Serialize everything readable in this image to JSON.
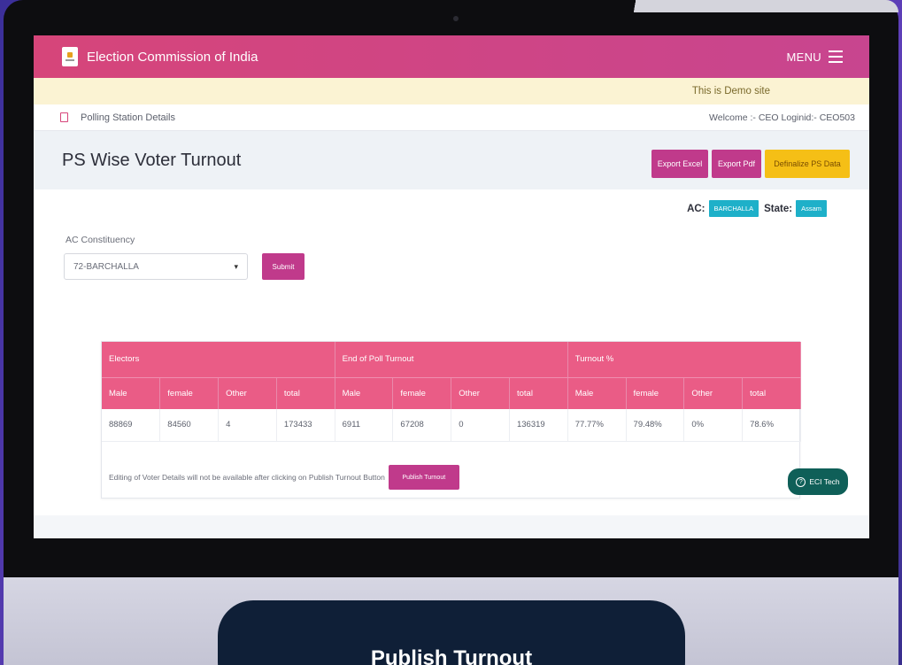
{
  "header": {
    "brand": "Election Commission of India",
    "menu_label": "MENU"
  },
  "demo_notice": "This is Demo site",
  "breadcrumb": {
    "label": "Polling Station Details",
    "welcome": "Welcome :- CEO Loginid:- CEO503"
  },
  "page": {
    "title": "PS Wise Voter Turnout",
    "export_excel": "Export Excel",
    "export_pdf": "Export Pdf",
    "definalize": "Definalize PS Data"
  },
  "context": {
    "ac_label": "AC:",
    "ac_value": "BARCHALLA",
    "state_label": "State:",
    "state_value": "Assam"
  },
  "form": {
    "label": "AC Constituency",
    "selected": "72-BARCHALLA",
    "submit": "Submit"
  },
  "table": {
    "groups": [
      "Electors",
      "End of Poll Turnout",
      "Turnout %"
    ],
    "columns": [
      "Male",
      "female",
      "Other",
      "total",
      "Male",
      "female",
      "Other",
      "total",
      "Male",
      "female",
      "Other",
      "total"
    ],
    "row": [
      "88869",
      "84560",
      "4",
      "173433",
      "6911",
      "67208",
      "0",
      "136319",
      "77.77%",
      "79.48%",
      "0%",
      "78.6%"
    ]
  },
  "note": {
    "text": "Editing of Voter Details will not be available after clicking on Publish Turnout Button",
    "button": "Publish Turnout"
  },
  "help": {
    "label": "ECI Tech"
  },
  "caption_button": "Publish Turnout",
  "colors": {
    "header": "#d6457a",
    "table_header": "#ea5c86",
    "button_pink": "#c03a8b",
    "button_yellow": "#f5bf16",
    "chip": "#1eb0c9",
    "caption_bg": "#0f1f37"
  }
}
